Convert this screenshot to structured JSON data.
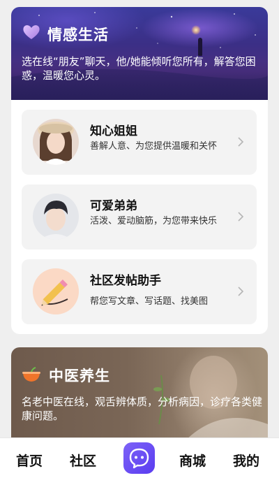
{
  "emotion_section": {
    "title": "情感生活",
    "description": "选在线“朋友”聊天，他/她能倾听您所有，解答您困惑，温暖您心灵。",
    "items": [
      {
        "name": "知心姐姐",
        "desc": "善解人意、为您提供温暖和关怀"
      },
      {
        "name": "可爱弟弟",
        "desc": "活泼、爱动脑筋，为您带来快乐"
      },
      {
        "name": "社区发帖助手",
        "desc": "帮您写文章、写话题、找美图"
      }
    ]
  },
  "tcm_section": {
    "title": "中医养生",
    "description": "名老中医在线，观舌辨体质，分析病因，诊疗各类健康问题。"
  },
  "tabbar": {
    "home": "首页",
    "community": "社区",
    "mall": "商城",
    "mine": "我的"
  },
  "colors": {
    "accent": "#6a4cf4",
    "heart_icon": "#c8a6f0",
    "bowl_icon": "#f0742a"
  },
  "icons": [
    "heart-icon",
    "chevron-right-icon",
    "pencil-icon",
    "bowl-icon",
    "chat-bubble-icon"
  ]
}
